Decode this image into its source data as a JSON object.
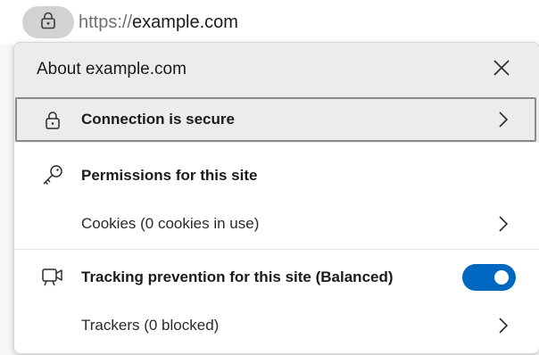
{
  "address_bar": {
    "url_scheme": "https://",
    "url_host": "example.com",
    "lock_icon": "lock-icon"
  },
  "flyout": {
    "title": "About example.com",
    "close_icon": "close-icon",
    "rows": {
      "connection": {
        "label": "Connection is secure",
        "icon": "lock-icon"
      },
      "permissions": {
        "label": "Permissions for this site",
        "icon": "key-icon"
      },
      "cookies": {
        "label": "Cookies (0 cookies in use)"
      },
      "tracking": {
        "label": "Tracking prevention for this site (Balanced)",
        "icon": "tracking-camera-icon",
        "toggle_on": true
      },
      "trackers": {
        "label": "Trackers (0 blocked)"
      }
    }
  },
  "colors": {
    "accent": "#0067c0",
    "header_bg": "#ececec",
    "focus_ring": "#8a8a8a"
  }
}
